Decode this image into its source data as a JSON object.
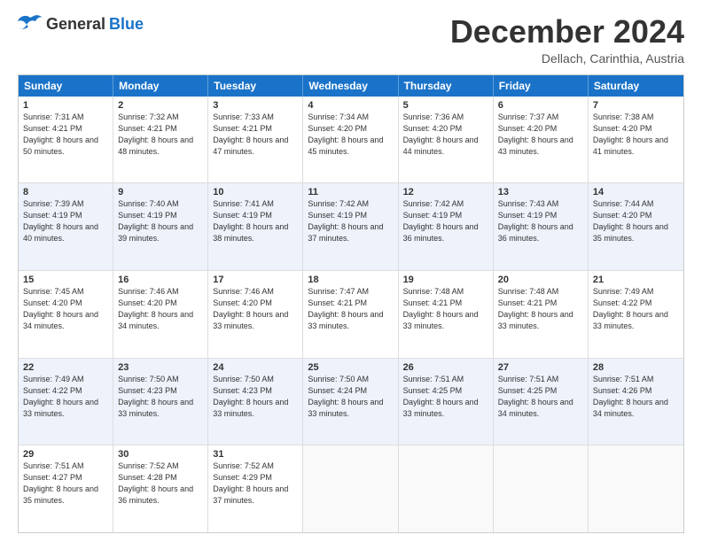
{
  "header": {
    "logo_general": "General",
    "logo_blue": "Blue",
    "title": "December 2024",
    "location": "Dellach, Carinthia, Austria"
  },
  "weekdays": [
    "Sunday",
    "Monday",
    "Tuesday",
    "Wednesday",
    "Thursday",
    "Friday",
    "Saturday"
  ],
  "rows": [
    [
      {
        "day": "1",
        "sunrise": "7:31 AM",
        "sunset": "4:21 PM",
        "daylight": "8 hours and 50 minutes."
      },
      {
        "day": "2",
        "sunrise": "7:32 AM",
        "sunset": "4:21 PM",
        "daylight": "8 hours and 48 minutes."
      },
      {
        "day": "3",
        "sunrise": "7:33 AM",
        "sunset": "4:21 PM",
        "daylight": "8 hours and 47 minutes."
      },
      {
        "day": "4",
        "sunrise": "7:34 AM",
        "sunset": "4:20 PM",
        "daylight": "8 hours and 45 minutes."
      },
      {
        "day": "5",
        "sunrise": "7:36 AM",
        "sunset": "4:20 PM",
        "daylight": "8 hours and 44 minutes."
      },
      {
        "day": "6",
        "sunrise": "7:37 AM",
        "sunset": "4:20 PM",
        "daylight": "8 hours and 43 minutes."
      },
      {
        "day": "7",
        "sunrise": "7:38 AM",
        "sunset": "4:20 PM",
        "daylight": "8 hours and 41 minutes."
      }
    ],
    [
      {
        "day": "8",
        "sunrise": "7:39 AM",
        "sunset": "4:19 PM",
        "daylight": "8 hours and 40 minutes."
      },
      {
        "day": "9",
        "sunrise": "7:40 AM",
        "sunset": "4:19 PM",
        "daylight": "8 hours and 39 minutes."
      },
      {
        "day": "10",
        "sunrise": "7:41 AM",
        "sunset": "4:19 PM",
        "daylight": "8 hours and 38 minutes."
      },
      {
        "day": "11",
        "sunrise": "7:42 AM",
        "sunset": "4:19 PM",
        "daylight": "8 hours and 37 minutes."
      },
      {
        "day": "12",
        "sunrise": "7:42 AM",
        "sunset": "4:19 PM",
        "daylight": "8 hours and 36 minutes."
      },
      {
        "day": "13",
        "sunrise": "7:43 AM",
        "sunset": "4:19 PM",
        "daylight": "8 hours and 36 minutes."
      },
      {
        "day": "14",
        "sunrise": "7:44 AM",
        "sunset": "4:20 PM",
        "daylight": "8 hours and 35 minutes."
      }
    ],
    [
      {
        "day": "15",
        "sunrise": "7:45 AM",
        "sunset": "4:20 PM",
        "daylight": "8 hours and 34 minutes."
      },
      {
        "day": "16",
        "sunrise": "7:46 AM",
        "sunset": "4:20 PM",
        "daylight": "8 hours and 34 minutes."
      },
      {
        "day": "17",
        "sunrise": "7:46 AM",
        "sunset": "4:20 PM",
        "daylight": "8 hours and 33 minutes."
      },
      {
        "day": "18",
        "sunrise": "7:47 AM",
        "sunset": "4:21 PM",
        "daylight": "8 hours and 33 minutes."
      },
      {
        "day": "19",
        "sunrise": "7:48 AM",
        "sunset": "4:21 PM",
        "daylight": "8 hours and 33 minutes."
      },
      {
        "day": "20",
        "sunrise": "7:48 AM",
        "sunset": "4:21 PM",
        "daylight": "8 hours and 33 minutes."
      },
      {
        "day": "21",
        "sunrise": "7:49 AM",
        "sunset": "4:22 PM",
        "daylight": "8 hours and 33 minutes."
      }
    ],
    [
      {
        "day": "22",
        "sunrise": "7:49 AM",
        "sunset": "4:22 PM",
        "daylight": "8 hours and 33 minutes."
      },
      {
        "day": "23",
        "sunrise": "7:50 AM",
        "sunset": "4:23 PM",
        "daylight": "8 hours and 33 minutes."
      },
      {
        "day": "24",
        "sunrise": "7:50 AM",
        "sunset": "4:23 PM",
        "daylight": "8 hours and 33 minutes."
      },
      {
        "day": "25",
        "sunrise": "7:50 AM",
        "sunset": "4:24 PM",
        "daylight": "8 hours and 33 minutes."
      },
      {
        "day": "26",
        "sunrise": "7:51 AM",
        "sunset": "4:25 PM",
        "daylight": "8 hours and 33 minutes."
      },
      {
        "day": "27",
        "sunrise": "7:51 AM",
        "sunset": "4:25 PM",
        "daylight": "8 hours and 34 minutes."
      },
      {
        "day": "28",
        "sunrise": "7:51 AM",
        "sunset": "4:26 PM",
        "daylight": "8 hours and 34 minutes."
      }
    ],
    [
      {
        "day": "29",
        "sunrise": "7:51 AM",
        "sunset": "4:27 PM",
        "daylight": "8 hours and 35 minutes."
      },
      {
        "day": "30",
        "sunrise": "7:52 AM",
        "sunset": "4:28 PM",
        "daylight": "8 hours and 36 minutes."
      },
      {
        "day": "31",
        "sunrise": "7:52 AM",
        "sunset": "4:29 PM",
        "daylight": "8 hours and 37 minutes."
      },
      null,
      null,
      null,
      null
    ]
  ]
}
